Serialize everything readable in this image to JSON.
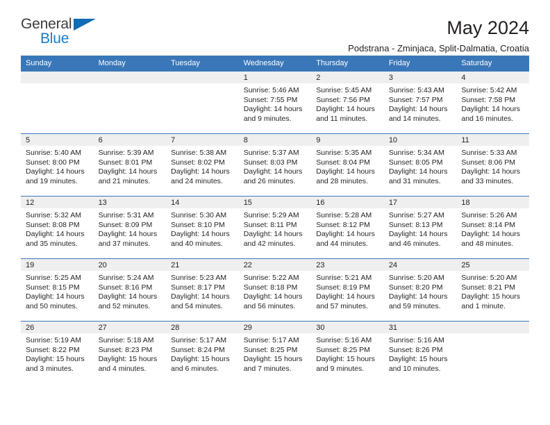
{
  "brand": {
    "name_part1": "General",
    "name_part2": "Blue",
    "triangle_color": "#0f6cb6",
    "blue_color": "#1b7ac4"
  },
  "header": {
    "title": "May 2024",
    "subtitle": "Podstrana - Zminjaca, Split-Dalmatia, Croatia",
    "accent_color": "#3a77b8",
    "band_color": "#efefef"
  },
  "weekdays": [
    "Sunday",
    "Monday",
    "Tuesday",
    "Wednesday",
    "Thursday",
    "Friday",
    "Saturday"
  ],
  "weeks": [
    [
      {
        "day": "",
        "empty": true
      },
      {
        "day": "",
        "empty": true
      },
      {
        "day": "",
        "empty": true
      },
      {
        "day": "1",
        "sunrise": "Sunrise: 5:46 AM",
        "sunset": "Sunset: 7:55 PM",
        "daylight_line1": "Daylight: 14 hours",
        "daylight_line2": "and 9 minutes."
      },
      {
        "day": "2",
        "sunrise": "Sunrise: 5:45 AM",
        "sunset": "Sunset: 7:56 PM",
        "daylight_line1": "Daylight: 14 hours",
        "daylight_line2": "and 11 minutes."
      },
      {
        "day": "3",
        "sunrise": "Sunrise: 5:43 AM",
        "sunset": "Sunset: 7:57 PM",
        "daylight_line1": "Daylight: 14 hours",
        "daylight_line2": "and 14 minutes."
      },
      {
        "day": "4",
        "sunrise": "Sunrise: 5:42 AM",
        "sunset": "Sunset: 7:58 PM",
        "daylight_line1": "Daylight: 14 hours",
        "daylight_line2": "and 16 minutes."
      }
    ],
    [
      {
        "day": "5",
        "sunrise": "Sunrise: 5:40 AM",
        "sunset": "Sunset: 8:00 PM",
        "daylight_line1": "Daylight: 14 hours",
        "daylight_line2": "and 19 minutes."
      },
      {
        "day": "6",
        "sunrise": "Sunrise: 5:39 AM",
        "sunset": "Sunset: 8:01 PM",
        "daylight_line1": "Daylight: 14 hours",
        "daylight_line2": "and 21 minutes."
      },
      {
        "day": "7",
        "sunrise": "Sunrise: 5:38 AM",
        "sunset": "Sunset: 8:02 PM",
        "daylight_line1": "Daylight: 14 hours",
        "daylight_line2": "and 24 minutes."
      },
      {
        "day": "8",
        "sunrise": "Sunrise: 5:37 AM",
        "sunset": "Sunset: 8:03 PM",
        "daylight_line1": "Daylight: 14 hours",
        "daylight_line2": "and 26 minutes."
      },
      {
        "day": "9",
        "sunrise": "Sunrise: 5:35 AM",
        "sunset": "Sunset: 8:04 PM",
        "daylight_line1": "Daylight: 14 hours",
        "daylight_line2": "and 28 minutes."
      },
      {
        "day": "10",
        "sunrise": "Sunrise: 5:34 AM",
        "sunset": "Sunset: 8:05 PM",
        "daylight_line1": "Daylight: 14 hours",
        "daylight_line2": "and 31 minutes."
      },
      {
        "day": "11",
        "sunrise": "Sunrise: 5:33 AM",
        "sunset": "Sunset: 8:06 PM",
        "daylight_line1": "Daylight: 14 hours",
        "daylight_line2": "and 33 minutes."
      }
    ],
    [
      {
        "day": "12",
        "sunrise": "Sunrise: 5:32 AM",
        "sunset": "Sunset: 8:08 PM",
        "daylight_line1": "Daylight: 14 hours",
        "daylight_line2": "and 35 minutes."
      },
      {
        "day": "13",
        "sunrise": "Sunrise: 5:31 AM",
        "sunset": "Sunset: 8:09 PM",
        "daylight_line1": "Daylight: 14 hours",
        "daylight_line2": "and 37 minutes."
      },
      {
        "day": "14",
        "sunrise": "Sunrise: 5:30 AM",
        "sunset": "Sunset: 8:10 PM",
        "daylight_line1": "Daylight: 14 hours",
        "daylight_line2": "and 40 minutes."
      },
      {
        "day": "15",
        "sunrise": "Sunrise: 5:29 AM",
        "sunset": "Sunset: 8:11 PM",
        "daylight_line1": "Daylight: 14 hours",
        "daylight_line2": "and 42 minutes."
      },
      {
        "day": "16",
        "sunrise": "Sunrise: 5:28 AM",
        "sunset": "Sunset: 8:12 PM",
        "daylight_line1": "Daylight: 14 hours",
        "daylight_line2": "and 44 minutes."
      },
      {
        "day": "17",
        "sunrise": "Sunrise: 5:27 AM",
        "sunset": "Sunset: 8:13 PM",
        "daylight_line1": "Daylight: 14 hours",
        "daylight_line2": "and 46 minutes."
      },
      {
        "day": "18",
        "sunrise": "Sunrise: 5:26 AM",
        "sunset": "Sunset: 8:14 PM",
        "daylight_line1": "Daylight: 14 hours",
        "daylight_line2": "and 48 minutes."
      }
    ],
    [
      {
        "day": "19",
        "sunrise": "Sunrise: 5:25 AM",
        "sunset": "Sunset: 8:15 PM",
        "daylight_line1": "Daylight: 14 hours",
        "daylight_line2": "and 50 minutes."
      },
      {
        "day": "20",
        "sunrise": "Sunrise: 5:24 AM",
        "sunset": "Sunset: 8:16 PM",
        "daylight_line1": "Daylight: 14 hours",
        "daylight_line2": "and 52 minutes."
      },
      {
        "day": "21",
        "sunrise": "Sunrise: 5:23 AM",
        "sunset": "Sunset: 8:17 PM",
        "daylight_line1": "Daylight: 14 hours",
        "daylight_line2": "and 54 minutes."
      },
      {
        "day": "22",
        "sunrise": "Sunrise: 5:22 AM",
        "sunset": "Sunset: 8:18 PM",
        "daylight_line1": "Daylight: 14 hours",
        "daylight_line2": "and 56 minutes."
      },
      {
        "day": "23",
        "sunrise": "Sunrise: 5:21 AM",
        "sunset": "Sunset: 8:19 PM",
        "daylight_line1": "Daylight: 14 hours",
        "daylight_line2": "and 57 minutes."
      },
      {
        "day": "24",
        "sunrise": "Sunrise: 5:20 AM",
        "sunset": "Sunset: 8:20 PM",
        "daylight_line1": "Daylight: 14 hours",
        "daylight_line2": "and 59 minutes."
      },
      {
        "day": "25",
        "sunrise": "Sunrise: 5:20 AM",
        "sunset": "Sunset: 8:21 PM",
        "daylight_line1": "Daylight: 15 hours",
        "daylight_line2": "and 1 minute."
      }
    ],
    [
      {
        "day": "26",
        "sunrise": "Sunrise: 5:19 AM",
        "sunset": "Sunset: 8:22 PM",
        "daylight_line1": "Daylight: 15 hours",
        "daylight_line2": "and 3 minutes."
      },
      {
        "day": "27",
        "sunrise": "Sunrise: 5:18 AM",
        "sunset": "Sunset: 8:23 PM",
        "daylight_line1": "Daylight: 15 hours",
        "daylight_line2": "and 4 minutes."
      },
      {
        "day": "28",
        "sunrise": "Sunrise: 5:17 AM",
        "sunset": "Sunset: 8:24 PM",
        "daylight_line1": "Daylight: 15 hours",
        "daylight_line2": "and 6 minutes."
      },
      {
        "day": "29",
        "sunrise": "Sunrise: 5:17 AM",
        "sunset": "Sunset: 8:25 PM",
        "daylight_line1": "Daylight: 15 hours",
        "daylight_line2": "and 7 minutes."
      },
      {
        "day": "30",
        "sunrise": "Sunrise: 5:16 AM",
        "sunset": "Sunset: 8:25 PM",
        "daylight_line1": "Daylight: 15 hours",
        "daylight_line2": "and 9 minutes."
      },
      {
        "day": "31",
        "sunrise": "Sunrise: 5:16 AM",
        "sunset": "Sunset: 8:26 PM",
        "daylight_line1": "Daylight: 15 hours",
        "daylight_line2": "and 10 minutes."
      },
      {
        "day": "",
        "empty": true
      }
    ]
  ]
}
